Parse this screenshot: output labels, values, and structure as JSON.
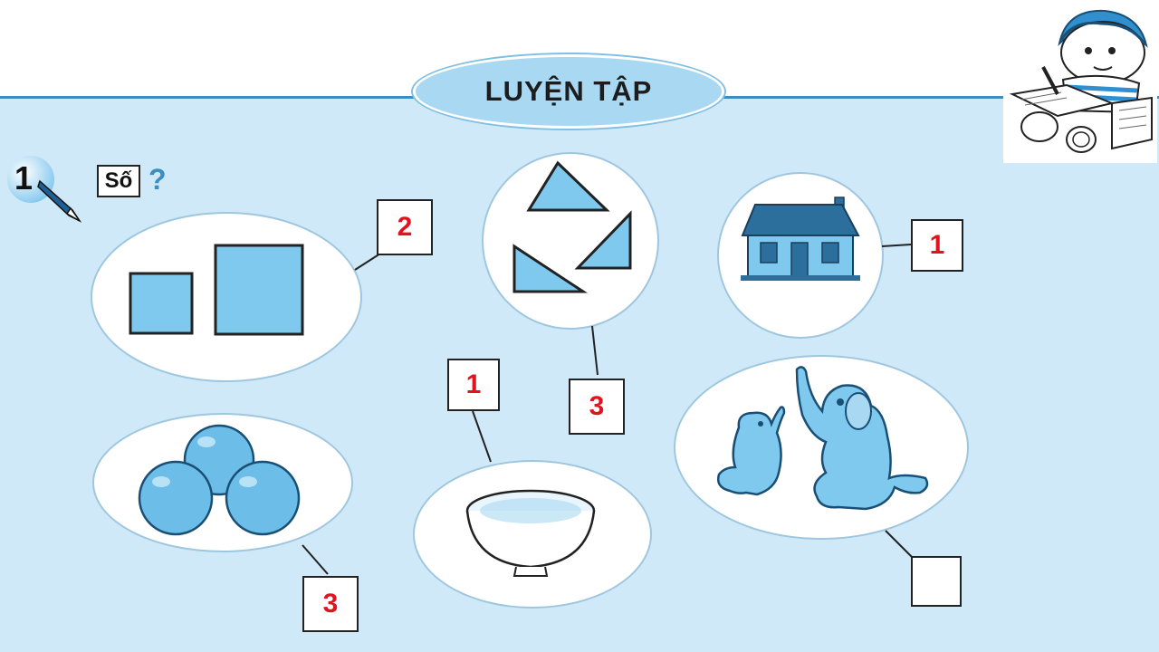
{
  "title": "LUYỆN TẬP",
  "exercise": {
    "number": "1",
    "label": "Số",
    "question_mark": "?"
  },
  "groups": [
    {
      "name": "squares",
      "answer": "2"
    },
    {
      "name": "triangles",
      "answer": "3"
    },
    {
      "name": "house",
      "answer": "1"
    },
    {
      "name": "oranges",
      "answer": "3"
    },
    {
      "name": "bowl",
      "answer": "1"
    },
    {
      "name": "elephants",
      "answer": ""
    }
  ],
  "colors": {
    "panel": "#cfe9f9",
    "shape_fill": "#7fc9ef",
    "answer_text": "#e0141e",
    "accent": "#3b8ec4"
  }
}
